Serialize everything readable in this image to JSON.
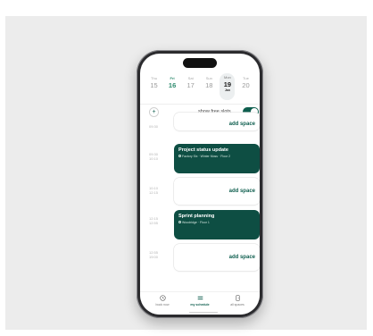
{
  "date_strip": {
    "days": [
      {
        "weekday": "Thu",
        "day": "15"
      },
      {
        "weekday": "Fri",
        "day": "16"
      },
      {
        "weekday": "Sat",
        "day": "17"
      },
      {
        "weekday": "Sun",
        "day": "18"
      },
      {
        "weekday": "Mon",
        "day": "19",
        "month": "Jan"
      },
      {
        "weekday": "Tue",
        "day": "20"
      }
    ]
  },
  "header": {
    "add_symbol": "+",
    "show_free_slots_label": "show free slots",
    "show_free_slots_on": true
  },
  "timeline": {
    "slot1": {
      "time_start": "09:30",
      "action": "add space"
    },
    "event1": {
      "time_start": "09:30",
      "time_end": "10:10",
      "title": "Project status update",
      "location": "Factory Six · Winter Moss · Floor 2"
    },
    "slot2": {
      "time_start": "10:10",
      "time_end": "12:15",
      "action": "add space"
    },
    "event2": {
      "time_start": "12:15",
      "time_end": "12:55",
      "title": "Sprint planning",
      "location": "Woodridge · Floor 1"
    },
    "slot3": {
      "time_start": "12:55",
      "time_end": "19:00",
      "action": "add space"
    }
  },
  "bottom_nav": {
    "items": [
      {
        "label": "book now",
        "icon": "clock-icon"
      },
      {
        "label": "my schedule",
        "icon": "list-icon"
      },
      {
        "label": "all spaces",
        "icon": "door-icon"
      }
    ]
  },
  "colors": {
    "accent": "#0e5e4e",
    "event_bg": "#0e4e43",
    "today": "#2e8b6e"
  }
}
